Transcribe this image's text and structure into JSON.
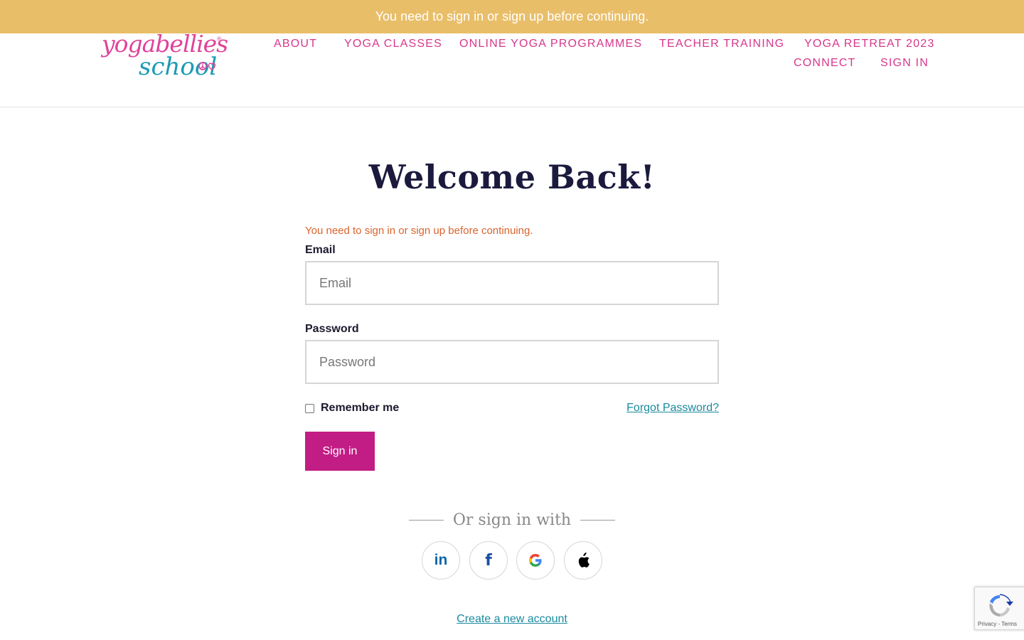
{
  "flash": {
    "message": "You need to sign in or sign up before continuing."
  },
  "logo": {
    "line1": "yogabellies",
    "line2": "school",
    "registered": "®"
  },
  "nav": {
    "items": [
      {
        "label": "ABOUT"
      },
      {
        "label": "YOGA CLASSES"
      },
      {
        "label": "ONLINE YOGA PROGRAMMES"
      },
      {
        "label": "TEACHER TRAINING"
      },
      {
        "label": "YOGA RETREAT 2023"
      },
      {
        "label": "CONNECT"
      },
      {
        "label": "SIGN IN"
      }
    ]
  },
  "login": {
    "title": "Welcome Back!",
    "alert": "You need to sign in or sign up before continuing.",
    "email_label": "Email",
    "email_placeholder": "Email",
    "email_value": "",
    "password_label": "Password",
    "password_placeholder": "Password",
    "password_value": "",
    "remember_label": "Remember me",
    "remember_checked": false,
    "forgot_label": "Forgot Password?",
    "submit_label": "Sign in",
    "divider_text": "Or sign in with",
    "social_providers": [
      {
        "name": "LinkedIn",
        "icon": "linkedin-icon",
        "glyph": "in"
      },
      {
        "name": "Facebook",
        "icon": "facebook-icon",
        "glyph": "f"
      },
      {
        "name": "Google",
        "icon": "google-icon",
        "glyph": "G"
      },
      {
        "name": "Apple",
        "icon": "apple-icon",
        "glyph": ""
      }
    ],
    "create_account_label": "Create a new account"
  },
  "recaptcha": {
    "footer": "Privacy - Terms"
  },
  "colors": {
    "flash_bg": "#e9be69",
    "nav_text": "#d8378c",
    "primary_button": "#c21d84",
    "link": "#1a8a9e",
    "alert_text": "#d9642d",
    "title_text": "#1b1a3d"
  }
}
